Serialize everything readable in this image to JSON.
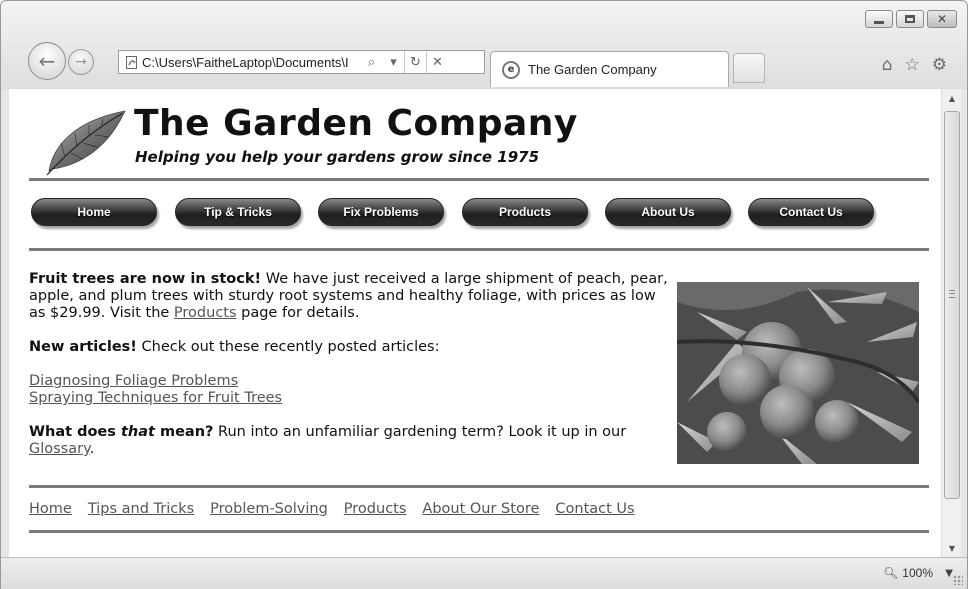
{
  "browser": {
    "address": "C:\\Users\\FaitheLaptop\\Documents\\I",
    "tab_title": "The Garden Company",
    "zoom": "100%",
    "icons": [
      "back-arrow-icon",
      "forward-arrow-icon",
      "page-icon",
      "search-icon",
      "dropdown-icon",
      "refresh-icon",
      "stop-icon",
      "ie-logo-icon",
      "home-icon",
      "favorites-star-icon",
      "settings-gear-icon",
      "minimize-icon",
      "maximize-icon",
      "close-icon",
      "zoom-icon"
    ]
  },
  "site": {
    "title": "The Garden Company",
    "tagline": "Helping you help your gardens grow since 1975"
  },
  "nav": {
    "items": [
      {
        "label": "Home"
      },
      {
        "label": "Tip & Tricks"
      },
      {
        "label": "Fix Problems"
      },
      {
        "label": "Products"
      },
      {
        "label": "About Us"
      },
      {
        "label": "Contact Us"
      }
    ]
  },
  "content": {
    "p1_bold": "Fruit trees are now in stock!",
    "p1_text": " We have just received a large shipment of peach, pear, apple, and plum trees with sturdy root systems and healthy foliage, with prices as low as $29.99. Visit the ",
    "p1_link": "Products",
    "p1_end": " page for details.",
    "p2_bold": "New articles!",
    "p2_text": " Check out these recently posted articles:",
    "articles": [
      "Diagnosing Foliage Problems",
      "Spraying Techniques for Fruit Trees"
    ],
    "p3_bold_a": "What does ",
    "p3_italic": "that",
    "p3_bold_b": " mean?",
    "p3_text": " Run into an unfamiliar gardening term? Look it up in our ",
    "p3_link": "Glossary",
    "p3_end": "."
  },
  "footer": {
    "links": [
      "Home",
      "Tips and Tricks",
      "Problem-Solving",
      "Products",
      "About Our Store",
      "Contact Us"
    ]
  },
  "colors": {
    "rule": "#7b7b7b",
    "link": "#555555",
    "button": "#1e1e1e"
  }
}
